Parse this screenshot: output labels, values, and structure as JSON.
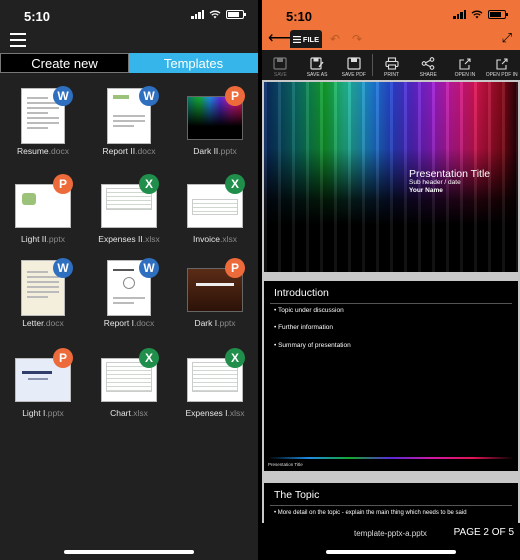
{
  "left": {
    "status": {
      "time": "5:10"
    },
    "tabs": {
      "create_new": "Create new",
      "templates": "Templates"
    },
    "templates": [
      {
        "name": "Resume",
        "ext": ".docx",
        "badge": "W"
      },
      {
        "name": "Report II",
        "ext": ".docx",
        "badge": "W"
      },
      {
        "name": "Dark II",
        "ext": ".pptx",
        "badge": "P"
      },
      {
        "name": "Light II",
        "ext": ".pptx",
        "badge": "P"
      },
      {
        "name": "Expenses II",
        "ext": ".xlsx",
        "badge": "X"
      },
      {
        "name": "Invoice",
        "ext": ".xlsx",
        "badge": "X"
      },
      {
        "name": "Letter",
        "ext": ".docx",
        "badge": "W"
      },
      {
        "name": "Report I",
        "ext": ".docx",
        "badge": "W"
      },
      {
        "name": "Dark I",
        "ext": ".pptx",
        "badge": "P"
      },
      {
        "name": "Light I",
        "ext": ".pptx",
        "badge": "P"
      },
      {
        "name": "Chart",
        "ext": ".xlsx",
        "badge": "X"
      },
      {
        "name": "Expenses I",
        "ext": ".xlsx",
        "badge": "X"
      }
    ],
    "colors": {
      "accent": "#35b5e9",
      "word": "#2f6fc0",
      "powerpoint": "#ed6b3b",
      "excel": "#1f8f4b"
    }
  },
  "right": {
    "status": {
      "time": "5:10"
    },
    "file_label": "FILE",
    "toolbar": [
      {
        "label": "SAVE",
        "icon": "floppy-icon",
        "enabled": false
      },
      {
        "label": "SAVE AS",
        "icon": "save-as-icon",
        "enabled": true
      },
      {
        "label": "SAVE PDF",
        "icon": "save-pdf-icon",
        "enabled": true
      },
      {
        "label": "PRINT",
        "icon": "printer-icon",
        "enabled": true
      },
      {
        "label": "SHARE",
        "icon": "share-icon",
        "enabled": true
      },
      {
        "label": "OPEN IN",
        "icon": "open-in-icon",
        "enabled": true
      },
      {
        "label": "OPEN PDF IN",
        "icon": "open-pdf-in-icon",
        "enabled": true
      }
    ],
    "slide1": {
      "title": "Presentation Title",
      "subheader": "Sub header / date",
      "name": "Your Name"
    },
    "slide2": {
      "title": "Introduction",
      "bullets": [
        "• Topic under discussion",
        "• Further information",
        "• Summary of presentation"
      ],
      "footer": "Presentation Title"
    },
    "slide3": {
      "title": "The Topic",
      "bullet": "• More detail on the topic - explain the main thing which needs to be said"
    },
    "footer": {
      "filename": "template-pptx-a.pptx",
      "page": "PAGE 2 OF 5"
    },
    "colors": {
      "accent": "#f0733a"
    }
  }
}
